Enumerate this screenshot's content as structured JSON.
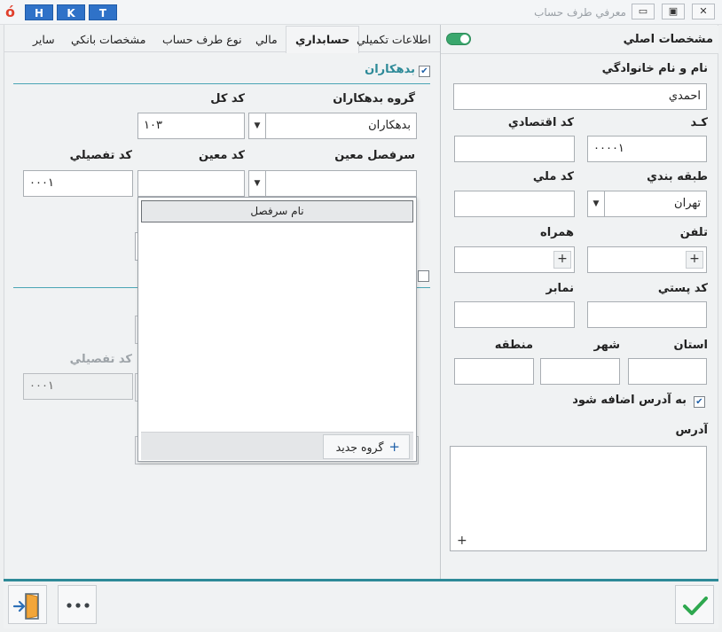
{
  "window": {
    "title": "معرفي طرف حساب",
    "hotkeys": [
      "H",
      "K",
      "T"
    ],
    "controls": [
      "▭",
      "▣",
      "✕"
    ]
  },
  "right_panel": {
    "title": "مشخصات اصلي",
    "full_name_label": "نام و نام خانوادگي",
    "full_name_value": "احمدي",
    "code_label": "کـد",
    "code_value": "۰۰۰۰۱",
    "economic_code_label": "کد اقتصادي",
    "economic_code_value": "",
    "category_label": "طبقه بندي",
    "category_value": "تهران",
    "national_code_label": "کد ملي",
    "national_code_value": "",
    "phone_label": "تلفن",
    "mobile_label": "همراه",
    "postal_code_label": "کد پستي",
    "fax_label": "نمابر",
    "province_label": "استان",
    "city_label": "شهر",
    "region_label": "منطقه",
    "add_to_address_label": "به آدرس اضافه شود",
    "address_label": "آدرس",
    "plus": "+"
  },
  "tabs": [
    {
      "label": "حسابداري"
    },
    {
      "label": "اطلاعات تكميلي"
    },
    {
      "label": "مالي"
    },
    {
      "label": "نوع طرف حساب"
    },
    {
      "label": "مشخصات بانكي"
    },
    {
      "label": "ساير"
    }
  ],
  "accounting": {
    "debtors_label": "بدهكاران",
    "debtor_group_label": "گروه بدهكاران",
    "debtor_group_value": "بدهكاران",
    "general_code_label": "كد كل",
    "general_code_value": "۱۰۳",
    "specific_heading_label": "سرفصل معين",
    "specific_code_label": "كد معين",
    "specific_code_value": "",
    "detail_code_label": "كد تفصيلي",
    "detail_code_value": "۰۰۰۱",
    "detail_code2_label": "كد تفصيلي",
    "detail_code2_value": "۰۰۰۱"
  },
  "dropdown": {
    "column_header": "نام سرفصل",
    "new_group_label": "گروه جديد",
    "new_group_plus": "+"
  }
}
